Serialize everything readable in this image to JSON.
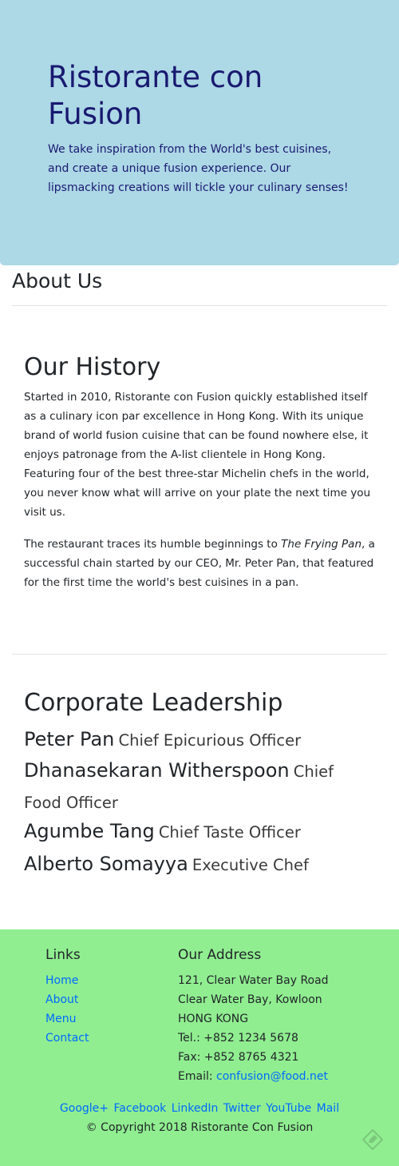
{
  "jumbotron": {
    "title": "Ristorante con Fusion",
    "tagline": "We take inspiration from the World's best cuisines, and create a unique fusion experience. Our lipsmacking creations will tickle your culinary senses!"
  },
  "page": {
    "title": "About Us"
  },
  "history": {
    "title": "Our History",
    "paragraph1": "Started in 2010, Ristorante con Fusion quickly established itself as a culinary icon par excellence in Hong Kong. With its unique brand of world fusion cuisine that can be found nowhere else, it enjoys patronage from the A-list clientele in Hong Kong. Featuring four of the best three-star Michelin chefs in the world, you never know what will arrive on your plate the next time you visit us.",
    "paragraph2_before": "The restaurant traces its humble beginnings to ",
    "paragraph2_italic": "The Frying Pan",
    "paragraph2_after": ", a successful chain started by our CEO, Mr. Peter Pan, that featured for the first time the world's best cuisines in a pan."
  },
  "leadership": {
    "title": "Corporate Leadership",
    "leaders": [
      {
        "name": "Peter Pan",
        "role": "Chief Epicurious Officer"
      },
      {
        "name": "Dhanasekaran Witherspoon",
        "role": "Chief Food Officer"
      },
      {
        "name": "Agumbe Tang",
        "role": "Chief Taste Officer"
      },
      {
        "name": "Alberto Somayya",
        "role": "Executive Chef"
      }
    ]
  },
  "footer": {
    "links_title": "Links",
    "links": [
      "Home",
      "About",
      "Menu",
      "Contact"
    ],
    "address_title": "Our Address",
    "address_line1": "121, Clear Water Bay Road",
    "address_line2": "Clear Water Bay, Kowloon",
    "address_line3": "HONG KONG",
    "tel": "Tel.: +852 1234 5678",
    "fax": "Fax: +852 8765 4321",
    "email_label": "Email: ",
    "email": "confusion@food.net",
    "social": [
      "Google+",
      "Facebook",
      "LinkedIn",
      "Twitter",
      "YouTube",
      "Mail"
    ],
    "copyright": "© Copyright 2018 Ristorante Con Fusion",
    "corner_icon": "edit-pencil-icon"
  },
  "colors": {
    "jumbotron_bg": "#add8e6",
    "jumbotron_text": "#191970",
    "footer_bg": "#90ee90",
    "link": "#0069ff"
  }
}
